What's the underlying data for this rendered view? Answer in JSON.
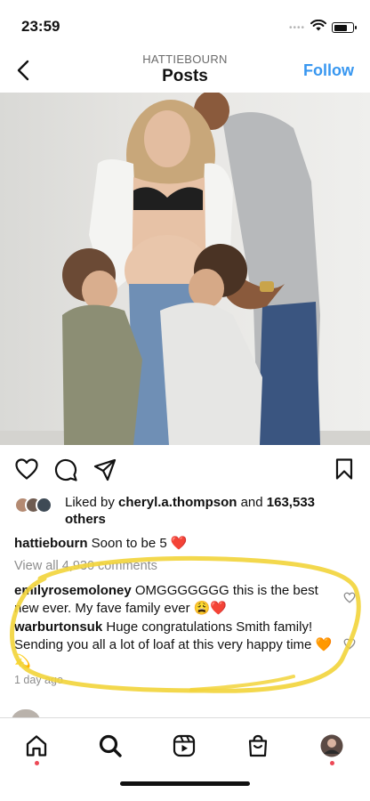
{
  "status_bar": {
    "time": "23:59"
  },
  "header": {
    "username": "HATTIEBOURN",
    "title": "Posts",
    "follow_label": "Follow"
  },
  "post": {
    "image_alt": "",
    "likes": {
      "prefix": "Liked by ",
      "liker": "cheryl.a.thompson",
      "middle": " and ",
      "count": "163,533",
      "suffix": "others"
    },
    "caption": {
      "user": "hattiebourn",
      "text": "Soon to be 5",
      "emoji": "❤️"
    },
    "view_all": "View all 4,930 comments",
    "comments": [
      {
        "user": "emilyrosemoloney",
        "text": "OMGGGGGGG this is the best new ever. My fave family ever",
        "emoji": "😩❤️"
      },
      {
        "user": "warburtonsuk",
        "text": "Huge congratulations Smith family! Sending you all a lot of loaf at this very happy time",
        "emoji": "🧡💫"
      }
    ],
    "time_ago": "1 day ago"
  },
  "tabbar": {
    "items": [
      "home",
      "search",
      "reels",
      "shop",
      "profile"
    ]
  },
  "colors": {
    "accent": "#3897f0",
    "highlight": "#f2d43a",
    "notify": "#ed4956",
    "muted": "#8e8e8e"
  }
}
